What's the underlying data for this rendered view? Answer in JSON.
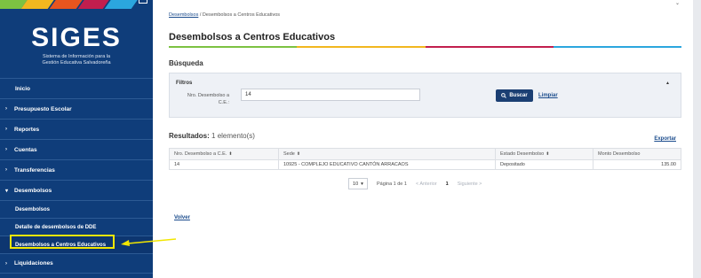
{
  "sidebar": {
    "logo_title": "SIGES",
    "logo_sub_line1": "Sistema de Información para la",
    "logo_sub_line2": "Gestión Educativa Salvadoreña",
    "brand_colors": [
      "#7cc242",
      "#f2b71f",
      "#e8551e",
      "#c21e4e",
      "#2ba6de",
      "#7cc242"
    ],
    "menu": [
      {
        "label": "Inicio",
        "caret": false
      },
      {
        "label": "Presupuesto Escolar",
        "caret": true
      },
      {
        "label": "Reportes",
        "caret": true
      },
      {
        "label": "Cuentas",
        "caret": true
      },
      {
        "label": "Transferencias",
        "caret": true
      },
      {
        "label": "Desembolsos",
        "caret": true,
        "expanded": true
      }
    ],
    "submenu": [
      {
        "label": "Desembolsos"
      },
      {
        "label": "Detalle de desembolsos de DDE"
      },
      {
        "label": "Desembolsos a Centros Educativos",
        "active": true
      }
    ],
    "menu_after": [
      {
        "label": "Liquidaciones",
        "caret": true
      }
    ]
  },
  "breadcrumb": {
    "link": "Desembolsos",
    "separator": "/",
    "current": "Desembolsos a Centros Educativos"
  },
  "page_title": "Desembolsos a Centros Educativos",
  "title_colors": [
    "#7cc242",
    "#f2b71f",
    "#c21e4e",
    "#2ba6de"
  ],
  "search": {
    "section_title": "Búsqueda",
    "filters_title": "Filtros",
    "field_label_line1": "Nro. Desembolso a",
    "field_label_line2": "C.E.:",
    "field_value": "14",
    "search_button": "Buscar",
    "clear_link": "Limpiar"
  },
  "results": {
    "title": "Resultados:",
    "count": "1 elemento(s)",
    "export_link": "Exportar",
    "columns": [
      "Nro. Desembolso a C.E.",
      "Sede",
      "Estado Desembolso",
      "Monto Desembolso"
    ],
    "rows": [
      [
        "14",
        "10925 - COMPLEJO EDUCATIVO CANTÓN ARRACAOS",
        "Depositado",
        "135.00"
      ]
    ]
  },
  "pager": {
    "page_size": "10",
    "page_info": "Página 1 de 1",
    "prev": "< Anterior",
    "current_page": "1",
    "next": "Siguiente >"
  },
  "back_link": "Volver"
}
